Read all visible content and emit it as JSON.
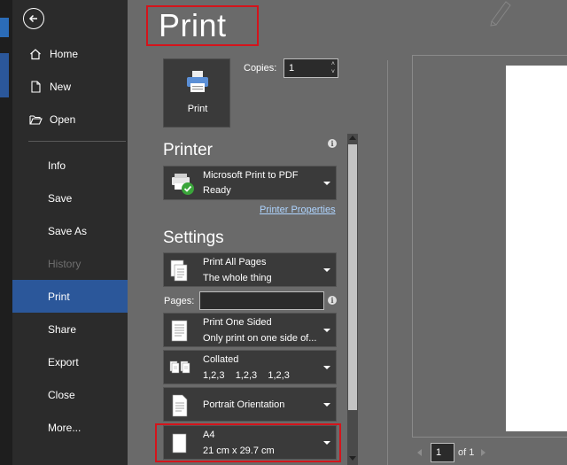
{
  "sidebar": {
    "items": [
      {
        "label": "Home"
      },
      {
        "label": "New"
      },
      {
        "label": "Open"
      },
      {
        "label": "Info"
      },
      {
        "label": "Save"
      },
      {
        "label": "Save As"
      },
      {
        "label": "History"
      },
      {
        "label": "Print"
      },
      {
        "label": "Share"
      },
      {
        "label": "Export"
      },
      {
        "label": "Close"
      },
      {
        "label": "More..."
      }
    ]
  },
  "main": {
    "title": "Print",
    "print_button_label": "Print",
    "copies_label": "Copies:",
    "copies_value": "1",
    "printer_section": "Printer",
    "printer": {
      "name": "Microsoft Print to PDF",
      "status": "Ready"
    },
    "printer_properties": "Printer Properties",
    "settings_section": "Settings",
    "settings": {
      "pages_range": {
        "l1": "Print All Pages",
        "l2": "The whole thing"
      },
      "pages_label": "Pages:",
      "pages_value": "",
      "sides": {
        "l1": "Print One Sided",
        "l2": "Only print on one side of..."
      },
      "collation": {
        "l1": "Collated",
        "l2": "1,2,3    1,2,3    1,2,3"
      },
      "orientation": {
        "l1": "Portrait Orientation"
      },
      "paper": {
        "l1": "A4",
        "l2": "21 cm x 29.7 cm"
      }
    },
    "preview": {
      "page_value": "1",
      "of_label": "of 1"
    }
  },
  "colors": {
    "accent": "#2b579a",
    "highlight_box": "#d4141b",
    "sidebar_bg": "#2b2b2b",
    "main_bg": "#6a6a6a"
  },
  "icons": [
    "back-arrow-icon",
    "home-icon",
    "new-doc-icon",
    "open-folder-icon",
    "printer-icon",
    "pdf-printer-ready-icon",
    "info-icon",
    "pages-icon",
    "one-sided-icon",
    "collated-icon",
    "portrait-icon",
    "paper-size-icon",
    "chevron-down-icon"
  ]
}
